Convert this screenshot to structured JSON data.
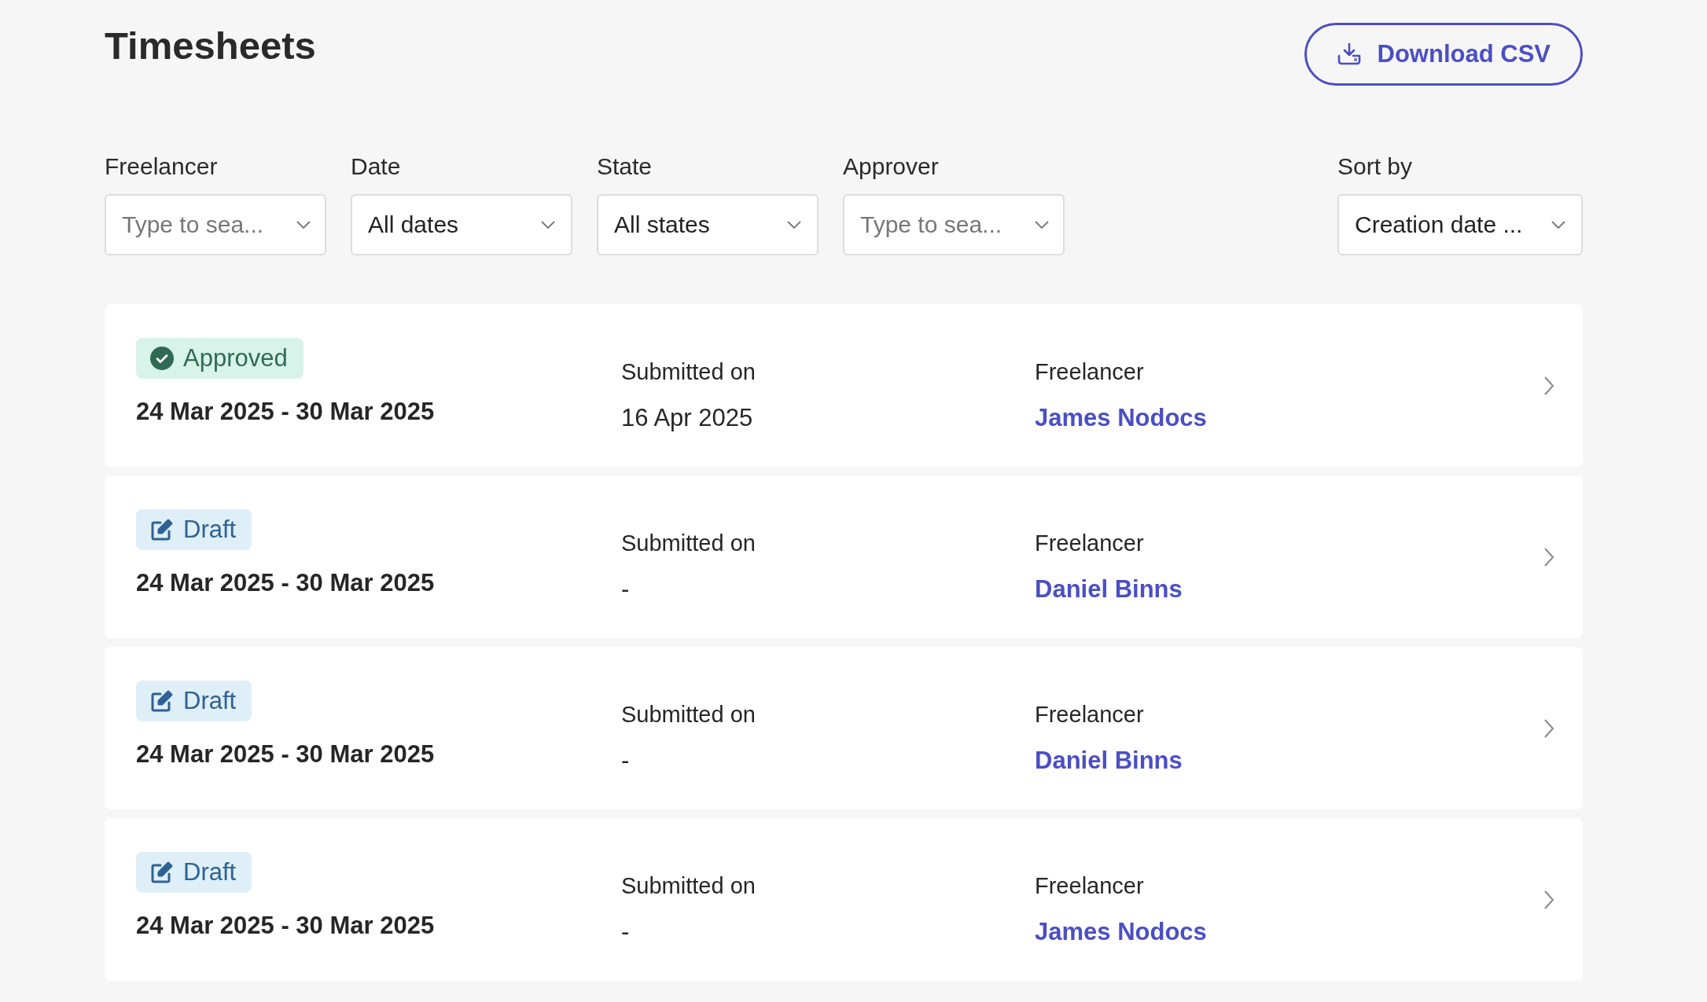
{
  "page": {
    "title": "Timesheets"
  },
  "download_button": {
    "label": "Download CSV"
  },
  "filters": [
    {
      "label": "Freelancer",
      "kind": "search",
      "placeholder": "Type to sea..."
    },
    {
      "label": "Date",
      "kind": "select",
      "value": "All dates"
    },
    {
      "label": "State",
      "kind": "select",
      "value": "All states"
    },
    {
      "label": "Approver",
      "kind": "search",
      "placeholder": "Type to sea..."
    }
  ],
  "sort": {
    "label": "Sort by",
    "value": "Creation date ..."
  },
  "timesheets": [
    {
      "status": {
        "kind": "approved",
        "label": "Approved"
      },
      "period": "24 Mar 2025 - 30 Mar 2025",
      "submitted_label": "Submitted on",
      "submitted": "16 Apr 2025",
      "freelancer_label": "Freelancer",
      "freelancer": "James Nodocs"
    },
    {
      "status": {
        "kind": "draft",
        "label": "Draft"
      },
      "period": "24 Mar 2025 - 30 Mar 2025",
      "submitted_label": "Submitted on",
      "submitted": "-",
      "freelancer_label": "Freelancer",
      "freelancer": "Daniel Binns"
    },
    {
      "status": {
        "kind": "draft",
        "label": "Draft"
      },
      "period": "24 Mar 2025 - 30 Mar 2025",
      "submitted_label": "Submitted on",
      "submitted": "-",
      "freelancer_label": "Freelancer",
      "freelancer": "Daniel Binns"
    },
    {
      "status": {
        "kind": "draft",
        "label": "Draft"
      },
      "period": "24 Mar 2025 - 30 Mar 2025",
      "submitted_label": "Submitted on",
      "submitted": "-",
      "freelancer_label": "Freelancer",
      "freelancer": "James Nodocs"
    }
  ]
}
